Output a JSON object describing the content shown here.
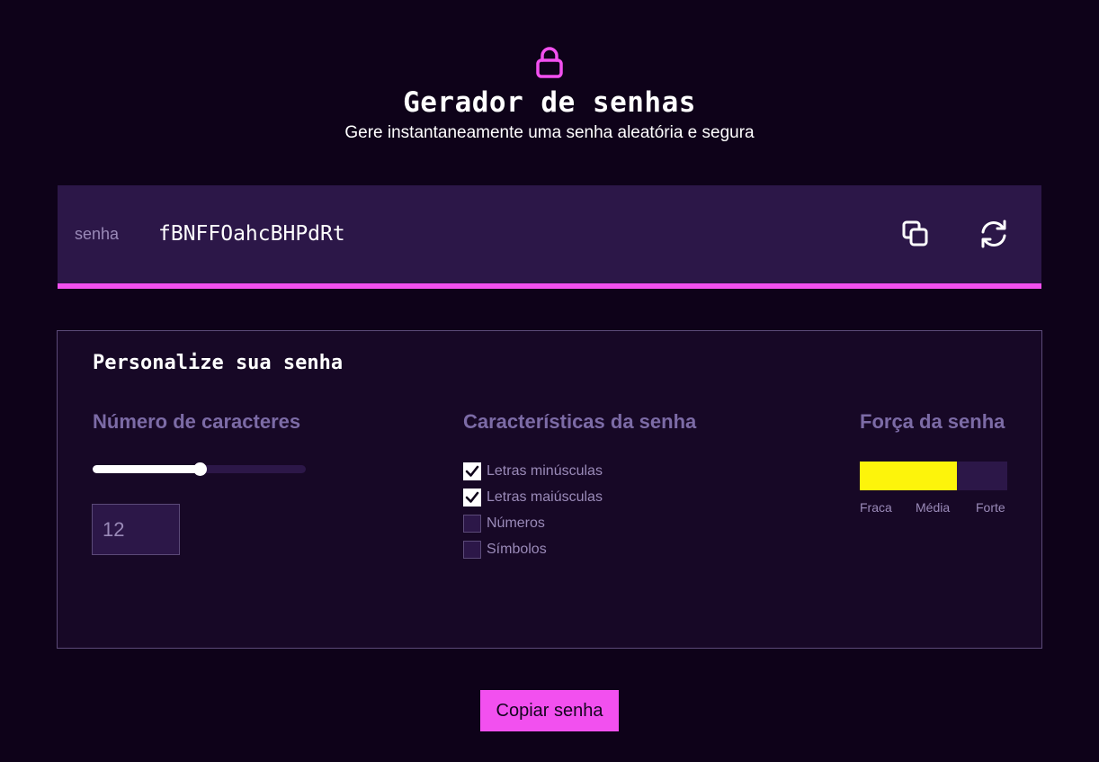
{
  "header": {
    "icon": "lock-icon",
    "title": "Gerador de senhas",
    "subtitle": "Gere instantaneamente uma senha aleatória e segura"
  },
  "password": {
    "label": "senha",
    "value": "fBNFFOahcBHPdRt",
    "copy_icon": "copy-icon",
    "refresh_icon": "refresh-icon"
  },
  "options": {
    "title": "Personalize sua senha",
    "length": {
      "heading": "Número de caracteres",
      "value": "12",
      "slider_fraction": 0.5
    },
    "characteristics": {
      "heading": "Características da senha",
      "items": [
        {
          "label": "Letras minúsculas",
          "checked": true
        },
        {
          "label": "Letras maiúsculas",
          "checked": true
        },
        {
          "label": "Números",
          "checked": false
        },
        {
          "label": "Símbolos",
          "checked": false
        }
      ]
    },
    "strength": {
      "heading": "Força da senha",
      "level_fraction": 0.66,
      "labels": [
        "Fraca",
        "Média",
        "Forte"
      ]
    }
  },
  "actions": {
    "copy_label": "Copiar senha"
  },
  "colors": {
    "background": "#0e0219",
    "accent": "#f250ef",
    "panel": "#170826",
    "bar": "#2c1748",
    "strength_fill": "#fdf40b",
    "muted_text": "#9a8ab8"
  }
}
